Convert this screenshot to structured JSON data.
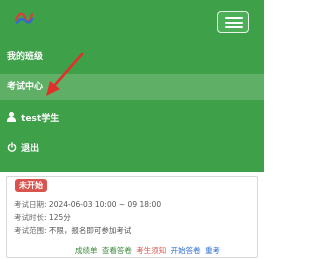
{
  "header": {
    "logo_icon": "app-logo-icon",
    "menu_icon": "hamburger-menu-icon"
  },
  "menu": {
    "items": [
      {
        "label": "我的班级"
      },
      {
        "label": "考试中心"
      },
      {
        "label": "test学生",
        "icon": "user-icon"
      },
      {
        "label": "退出",
        "icon": "power-icon"
      }
    ]
  },
  "exam_card": {
    "status": "未开始",
    "date_label": "考试日期:",
    "date_value": "2024-06-03 10:00 ~ 09 18:00",
    "duration_label": "考试时长:",
    "duration_value": "125分",
    "scope_label": "考试范围:",
    "scope_value": "不限，报名即可参加考试",
    "links": [
      "成绩单",
      "查看答卷",
      "考生须知",
      "开始答卷",
      "重考"
    ]
  },
  "colors": {
    "nav_green": "#3fa04a",
    "active_item": "#5fb066",
    "badge_red": "#d9534f",
    "link_green": "#3a8a3a",
    "link_red": "#d9534f",
    "link_blue": "#2a6bd6",
    "annotation_arrow": "#e0302a"
  }
}
